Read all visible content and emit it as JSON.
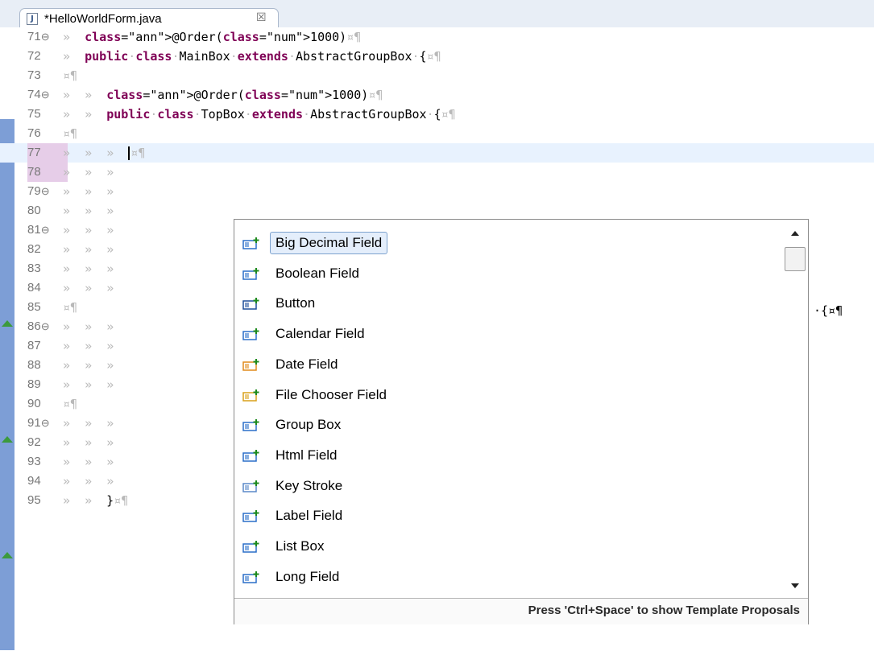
{
  "tab": {
    "title": "*HelloWorldForm.java",
    "close_glyph": "☒",
    "icon_letter": "J"
  },
  "editor": {
    "lines": [
      {
        "n": "71",
        "fold": "⊖",
        "code": "»  @Order(1000)¤¶"
      },
      {
        "n": "72",
        "fold": "",
        "code": "»  public·class·MainBox·extends·AbstractGroupBox·{¤¶"
      },
      {
        "n": "73",
        "fold": "",
        "code": "¤¶"
      },
      {
        "n": "74",
        "fold": "⊖",
        "code": "»  »  @Order(1000)¤¶"
      },
      {
        "n": "75",
        "fold": "",
        "code": "»  »  public·class·TopBox·extends·AbstractGroupBox·{¤¶"
      },
      {
        "n": "76",
        "fold": "",
        "code": "¤¶"
      },
      {
        "n": "77",
        "fold": "",
        "code": "»  »  »  ¤¶"
      },
      {
        "n": "78",
        "fold": "",
        "code": "»  »  »"
      },
      {
        "n": "79",
        "fold": "⊖",
        "code": "»  »  »"
      },
      {
        "n": "80",
        "fold": "",
        "code": "»  »  »"
      },
      {
        "n": "81",
        "fold": "⊖",
        "code": "»  »  »"
      },
      {
        "n": "82",
        "fold": "",
        "code": "»  »  »"
      },
      {
        "n": "83",
        "fold": "",
        "code": "»  »  »"
      },
      {
        "n": "84",
        "fold": "",
        "code": "»  »  »"
      },
      {
        "n": "85",
        "fold": "",
        "code": "¤¶"
      },
      {
        "n": "86",
        "fold": "⊖",
        "code": "»  »  »"
      },
      {
        "n": "87",
        "fold": "",
        "code": "»  »  »"
      },
      {
        "n": "88",
        "fold": "",
        "code": "»  »  »"
      },
      {
        "n": "89",
        "fold": "",
        "code": "»  »  »"
      },
      {
        "n": "90",
        "fold": "",
        "code": "¤¶"
      },
      {
        "n": "91",
        "fold": "⊖",
        "code": "»  »  »"
      },
      {
        "n": "92",
        "fold": "",
        "code": "»  »  »"
      },
      {
        "n": "93",
        "fold": "",
        "code": "»  »  »"
      },
      {
        "n": "94",
        "fold": "",
        "code": "»  »  »"
      },
      {
        "n": "95",
        "fold": "",
        "code": "»  »  }¤¶"
      }
    ],
    "behind_popup_text": "·{¤¶"
  },
  "completion": {
    "items": [
      {
        "label": "Big Decimal Field",
        "icon": "bigdecimal-field-icon",
        "selected": true
      },
      {
        "label": "Boolean Field",
        "icon": "field-icon"
      },
      {
        "label": "Button",
        "icon": "button-icon"
      },
      {
        "label": "Calendar Field",
        "icon": "field-icon"
      },
      {
        "label": "Date Field",
        "icon": "date-field-icon"
      },
      {
        "label": "File Chooser Field",
        "icon": "file-chooser-field-icon"
      },
      {
        "label": "Group Box",
        "icon": "group-box-icon"
      },
      {
        "label": "Html Field",
        "icon": "field-icon"
      },
      {
        "label": "Key Stroke",
        "icon": "key-stroke-icon"
      },
      {
        "label": "Label Field",
        "icon": "field-icon"
      },
      {
        "label": "List Box",
        "icon": "field-icon"
      },
      {
        "label": "Long Field",
        "icon": "long-field-icon"
      }
    ],
    "status": "Press 'Ctrl+Space' to show Template Proposals"
  },
  "colors": {
    "keyword": "#7f0055",
    "annotation": "#646464",
    "whitespace": "#b9b9b9",
    "current_line": "#e8f2fe",
    "quickdiff": "#7d9ed6"
  }
}
